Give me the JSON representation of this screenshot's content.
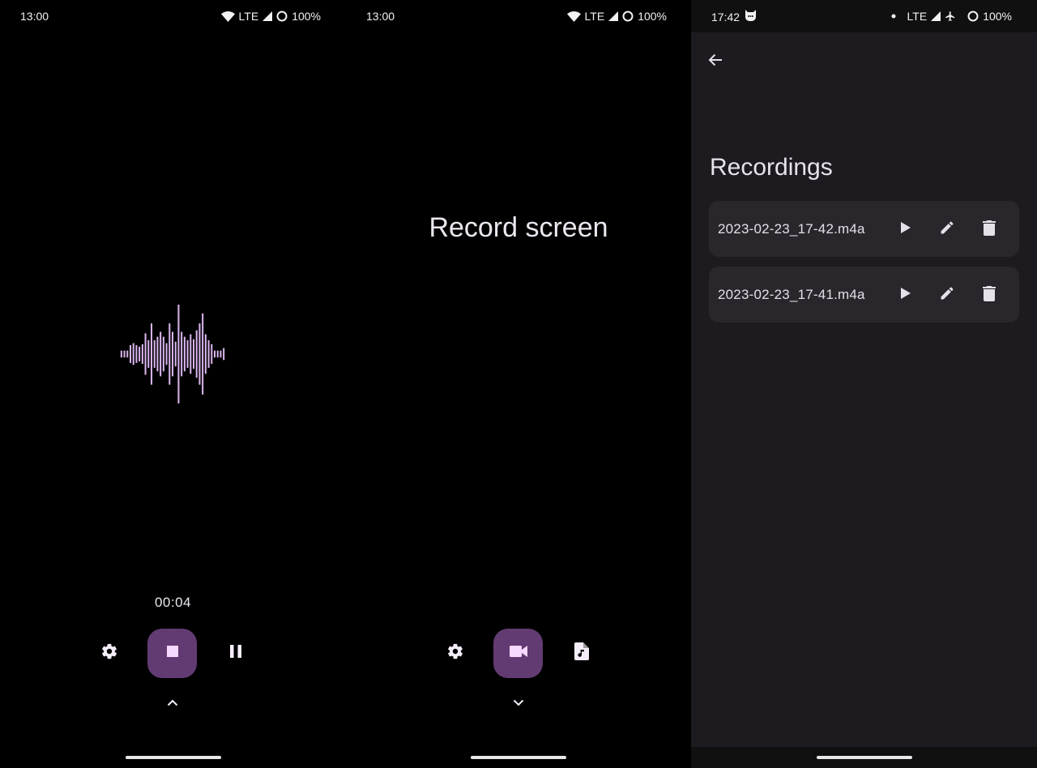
{
  "screens": [
    {
      "id": "audio-recording",
      "status_bar": {
        "time": "13:00",
        "network": "LTE",
        "battery": "100%",
        "icons": [
          "wifi-icon",
          "signal-icon",
          "battery-saver-icon"
        ]
      },
      "timer": "00:04",
      "controls": {
        "left": "settings",
        "primary": "stop",
        "right": "pause",
        "bottom": "chevron-up"
      },
      "waveform": {
        "color": "#d8b4ec",
        "amplitudes": [
          0.07,
          0.07,
          0.07,
          0.18,
          0.22,
          0.18,
          0.15,
          0.2,
          0.42,
          0.28,
          0.62,
          0.28,
          0.35,
          0.45,
          0.35,
          0.22,
          0.62,
          0.45,
          0.25,
          1.0,
          0.45,
          0.35,
          0.28,
          0.4,
          0.3,
          0.48,
          0.62,
          0.82,
          0.4,
          0.28,
          0.2,
          0.07,
          0.07,
          0.07,
          0.12
        ]
      }
    },
    {
      "id": "screen-recording",
      "status_bar": {
        "time": "13:00",
        "network": "LTE",
        "battery": "100%",
        "icons": [
          "wifi-icon",
          "signal-icon",
          "battery-saver-icon"
        ]
      },
      "title": "Record screen",
      "controls": {
        "left": "settings",
        "primary": "video-camera",
        "right": "audio-file",
        "bottom": "chevron-down"
      }
    },
    {
      "id": "recordings-list",
      "status_bar": {
        "time": "17:42",
        "network": "LTE",
        "battery": "100%",
        "icons": [
          "app-notification-icon",
          "dot-icon",
          "signal-icon",
          "airplane-icon",
          "battery-saver-icon"
        ]
      },
      "back_label": "Back",
      "heading": "Recordings",
      "recordings": [
        {
          "name": "2023-02-23_17-42.m4a"
        },
        {
          "name": "2023-02-23_17-41.m4a"
        }
      ]
    }
  ],
  "colors": {
    "accent": "#633b73",
    "on_accent": "#f5d9ff",
    "surface": "#1d1b1f",
    "card": "#2a272c"
  }
}
